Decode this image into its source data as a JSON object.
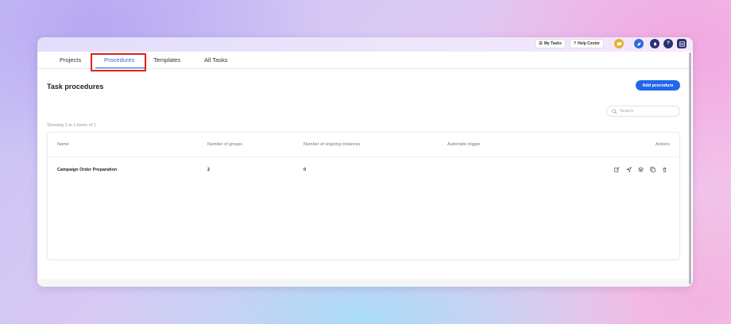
{
  "topbar": {
    "my_tasks_label": "My Tasks",
    "help_center_label": "Help Center",
    "help_icon_glyph": "?"
  },
  "tabs": [
    {
      "label": "Projects",
      "active": false
    },
    {
      "label": "Procedures",
      "active": true
    },
    {
      "label": "Templates",
      "active": false
    },
    {
      "label": "All Tasks",
      "active": false
    }
  ],
  "page": {
    "title": "Task procedures",
    "add_button_label": "Add procedure",
    "search_placeholder": "Search",
    "showing_text": "Showing 1 to 1 items of 1"
  },
  "table": {
    "headers": [
      "Name",
      "Number of groups",
      "Number of ongoing instances",
      "Automatic trigger",
      "Actions"
    ],
    "rows": [
      {
        "name": "Campaign Order Preparation",
        "groups": "2",
        "ongoing": "0",
        "trigger": ""
      }
    ]
  },
  "colors": {
    "accent": "#2167e8",
    "highlight": "#e0201b",
    "navy": "#2b3170",
    "yellow": "#e3b12e"
  }
}
